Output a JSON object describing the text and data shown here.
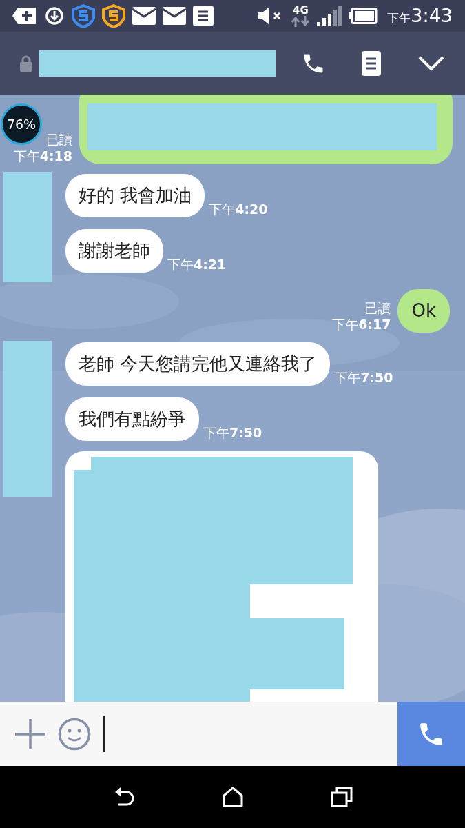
{
  "status_bar": {
    "time_prefix": "下午",
    "time": "3:43",
    "network": "4G"
  },
  "overlay_widget": {
    "text": "76%"
  },
  "chat": [
    {
      "outgoing": true,
      "messages": [
        {
          "kind": "redacted",
          "read": "已讀",
          "time": "下午**4:18**"
        }
      ]
    },
    {
      "outgoing": false,
      "messages": [
        {
          "kind": "text",
          "text": "好的 我會加油",
          "time": "下午**4:20**"
        },
        {
          "kind": "text",
          "text": "謝謝老師",
          "time": "下午**4:21**"
        }
      ]
    },
    {
      "outgoing": true,
      "messages": [
        {
          "kind": "text",
          "text": "Ok",
          "read": "已讀",
          "time": "下午**6:17**"
        }
      ]
    },
    {
      "outgoing": false,
      "messages": [
        {
          "kind": "text",
          "text": "老師 今天您講完他又連絡我了",
          "time": "下午**7:50**"
        },
        {
          "kind": "text",
          "text": "我們有點紛爭",
          "time": "下午**7:50**"
        },
        {
          "kind": "redacted_long"
        }
      ]
    }
  ]
}
